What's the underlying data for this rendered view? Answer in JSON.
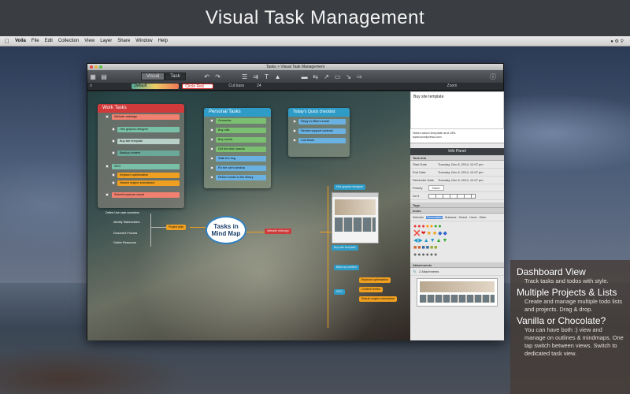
{
  "headline": "Visual Task Management",
  "menubar": {
    "app": "Voila",
    "items": [
      "File",
      "Edit",
      "Collection",
      "View",
      "Layer",
      "Share",
      "Window",
      "Help"
    ]
  },
  "window": {
    "title": "Tasks > Visual Task Management",
    "tabs": [
      "Visual",
      "Task"
    ],
    "format": {
      "style": "Default",
      "font": "Circle Red",
      "weight": "Cut bass",
      "size": "24",
      "zoom_label": "Zoom"
    }
  },
  "lists": {
    "work": {
      "title": "Work Tasks",
      "items": [
        "Website redesign",
        "Hire graphic designer",
        "Buy site template",
        "Backup content",
        "SEO",
        "Keyword optimization",
        "Search engine submission",
        "Submit expense report"
      ]
    },
    "personal": {
      "title": "Personal Tasks",
      "items": [
        "Groceries",
        "Buy milk",
        "Buy cereal",
        "Get the kids' snacks",
        "Walk the dog",
        "Fix the car's window",
        "Return books to the library"
      ]
    },
    "quick": {
      "title": "Today's Quick checklist",
      "items": [
        "Reply to Mike's email",
        "Review support contract",
        "Call Dawn"
      ]
    }
  },
  "mindmap": {
    "center": "Tasks in Mind Map",
    "left": [
      "Define Use case scenarios",
      "Identify Stakeholders",
      "Document Process",
      "Gather Resources"
    ],
    "left_hub": "Project plan",
    "right_hub": "Website redesign",
    "right_top": "Hire graphic designer",
    "right_mid": "Buy site template",
    "right_low": "Back up content",
    "seo": "SEO",
    "seo_children": [
      "Keyword optimization",
      "Content review",
      "Search engine submission"
    ]
  },
  "panel": {
    "note_title": "Buy site template",
    "note_text": "Notes about template and URL",
    "note_url": "www.wordpress.com",
    "header": "Info Panel",
    "task_info": "Task Info",
    "rows": [
      {
        "label": "Start Date",
        "value": "Tuesday, Dec 8, 2014, 12:07 pm"
      },
      {
        "label": "End Date",
        "value": "Tuesday, Dec 8, 2014, 12:07 pm"
      },
      {
        "label": "Reminder Date",
        "value": "Tuesday, Dec 8, 2014, 12:07 pm"
      }
    ],
    "priority_label": "Priority",
    "priority_value": "None",
    "do_label": "Do it",
    "tags": "Tags",
    "icons": "Icons",
    "icon_tabs": [
      "Selected",
      "Presentation",
      "Business",
      "School",
      "Home",
      "Other"
    ],
    "attachments": "Attachments",
    "attach_count": "2 Attachments"
  },
  "tips": [
    {
      "title": "Dashboard View",
      "text": "Track tasks and todos with style."
    },
    {
      "title": "Multiple Projects & Lists",
      "text": "Create and manage multiple todo lists and projects. Drag & drop."
    },
    {
      "title": "Vanilla or Chocolate?",
      "text": "You can have both :) view and manage on outlines & mindmaps. One tap switch between views. Switch to dedicated task view."
    }
  ],
  "colors": {
    "work_head": "#d03a3a",
    "personal_head": "#2f9cc8",
    "quick_head": "#2f9cc8",
    "accent": "#f0a020"
  }
}
